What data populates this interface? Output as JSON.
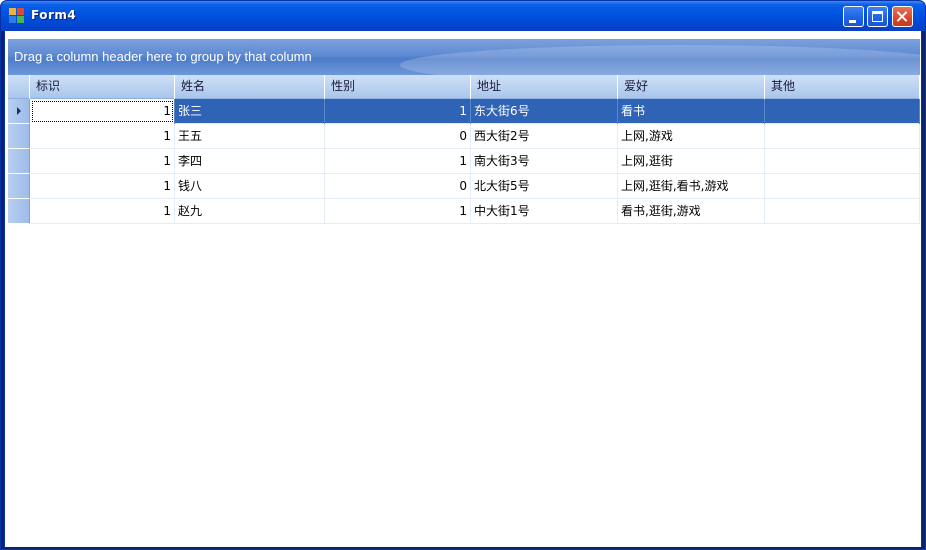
{
  "window": {
    "title": "Form4"
  },
  "group_panel": {
    "text": "Drag a column header here to group by that column"
  },
  "columns": [
    "标识",
    "姓名",
    "性别",
    "地址",
    "爱好",
    "其他"
  ],
  "rows": [
    {
      "id": "1",
      "name": "张三",
      "gender": "1",
      "address": "东大街6号",
      "hobby": "看书",
      "other": ""
    },
    {
      "id": "1",
      "name": "王五",
      "gender": "0",
      "address": "西大街2号",
      "hobby": "上网,游戏",
      "other": ""
    },
    {
      "id": "1",
      "name": "李四",
      "gender": "1",
      "address": "南大街3号",
      "hobby": "上网,逛街",
      "other": ""
    },
    {
      "id": "1",
      "name": "钱八",
      "gender": "0",
      "address": "北大街5号",
      "hobby": "上网,逛街,看书,游戏",
      "other": ""
    },
    {
      "id": "1",
      "name": "赵九",
      "gender": "1",
      "address": "中大街1号",
      "hobby": "看书,逛街,游戏",
      "other": ""
    }
  ],
  "selected_row": 0,
  "colors": {
    "titlebar": "#0054e3",
    "selection": "#2f63b6",
    "close_button": "#d9462a"
  },
  "icons": [
    "app-icon",
    "minimize-icon",
    "maximize-icon",
    "close-icon",
    "row-indicator-arrow-icon"
  ]
}
